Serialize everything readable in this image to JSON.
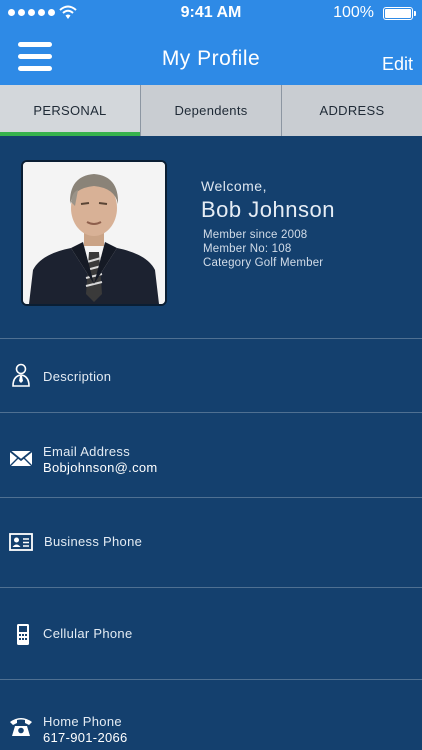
{
  "status_bar": {
    "time": "9:41 AM",
    "battery": "100%"
  },
  "header": {
    "title": "My Profile",
    "edit_label": "Edit"
  },
  "tabs": [
    {
      "label": "PERSONAL",
      "active": true
    },
    {
      "label": "Dependents",
      "active": false
    },
    {
      "label": "ADDRESS",
      "active": false
    }
  ],
  "profile": {
    "welcome": "Welcome,",
    "name": "Bob Johnson",
    "member_since": "Member since 2008",
    "member_no": "Member No: 108",
    "category": "Category Golf Member"
  },
  "rows": [
    {
      "label": "Description",
      "value": "",
      "icon": "person-tie-icon"
    },
    {
      "label": "Email Address",
      "value": "Bobjohnson@.com",
      "icon": "envelope-icon"
    },
    {
      "label": "Business Phone",
      "value": "",
      "icon": "id-card-icon"
    },
    {
      "label": "Cellular Phone",
      "value": "",
      "icon": "mobile-phone-icon"
    },
    {
      "label": "Home Phone",
      "value": "617-901-2066",
      "icon": "telephone-icon"
    }
  ],
  "colors": {
    "header": "#2e8ae6",
    "background": "#14406e",
    "tab_bar": "#c9cdd2",
    "active_tab_indicator": "#37b24d"
  }
}
